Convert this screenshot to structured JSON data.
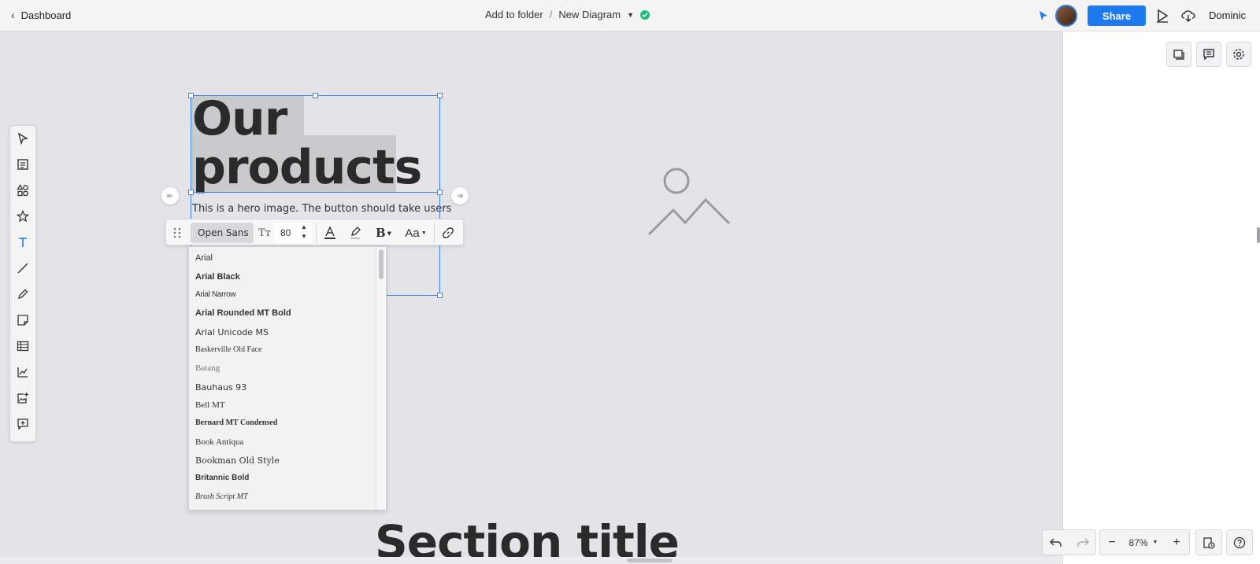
{
  "topbar": {
    "back_label": "Dashboard",
    "breadcrumb_folder": "Add to folder",
    "breadcrumb_separator": "/",
    "diagram_name": "New Diagram",
    "share_label": "Share",
    "user_name": "Dominic"
  },
  "canvas": {
    "hero_title_line1": "Our",
    "hero_title_line2": "products",
    "hero_subtitle": "This is a hero image. The button should take users",
    "section_title": "Section title"
  },
  "format_toolbar": {
    "font_name": "Open Sans",
    "font_size": "80",
    "text_size_glyph": "Tт",
    "bold_glyph": "B",
    "case_glyph": "Aa"
  },
  "font_dropdown": {
    "options": [
      "Arial",
      "Arial Black",
      "Arial Narrow",
      "Arial Rounded MT Bold",
      "Arial Unicode MS",
      "Baskerville Old Face",
      "Batang",
      "Bauhaus 93",
      "Bell MT",
      "Bernard MT Condensed",
      "Book Antiqua",
      "Bookman Old Style",
      "Britannic Bold",
      "Brush Script MT"
    ]
  },
  "zoom": {
    "level": "87%",
    "minus": "−",
    "plus": "+"
  },
  "icons": {
    "left_toolbar": [
      "pointer-icon",
      "page-icon",
      "shapes-icon",
      "star-icon",
      "text-icon",
      "line-icon",
      "pen-icon",
      "sticky-note-icon",
      "table-icon",
      "chart-icon",
      "image-icon",
      "comment-add-icon"
    ],
    "right_panel": [
      "pages-icon",
      "comments-icon",
      "settings-icon"
    ]
  },
  "colors": {
    "accent": "#1f7af0",
    "saved": "#1fbf75",
    "selection": "#3d86f0"
  }
}
